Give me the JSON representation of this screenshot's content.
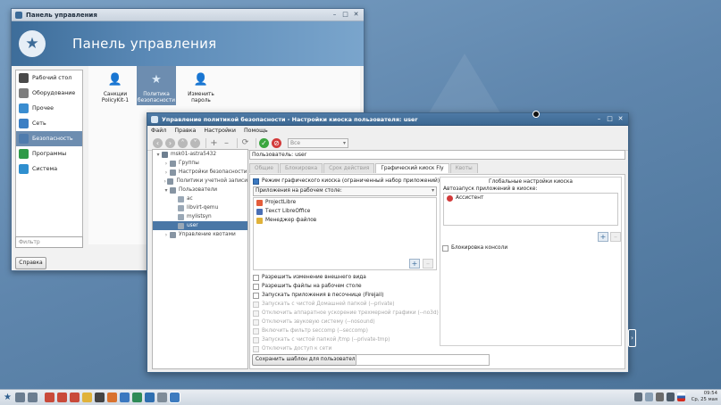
{
  "control_panel": {
    "window_title": "Панель управления",
    "banner_title": "Панель управления",
    "sidebar": [
      {
        "label": "Рабочий стол",
        "color": "#4a4a4a"
      },
      {
        "label": "Оборудование",
        "color": "#7e7e7e"
      },
      {
        "label": "Прочее",
        "color": "#3a8dd0"
      },
      {
        "label": "Сеть",
        "color": "#3b7fc4"
      },
      {
        "label": "Безопасность",
        "color": "#4f7cad"
      },
      {
        "label": "Программы",
        "color": "#2f9a48"
      },
      {
        "label": "Система",
        "color": "#2f8fcf"
      }
    ],
    "active_sidebar_index": 4,
    "tiles": [
      {
        "label": "Санкции PolicyKit-1",
        "icon": "user-admin-icon"
      },
      {
        "label": "Политика безопасности",
        "icon": "security-policy-icon"
      },
      {
        "label": "Изменить пароль",
        "icon": "change-password-icon"
      }
    ],
    "filter_placeholder": "Фильтр",
    "help_button": "Справка"
  },
  "security_window": {
    "title": "Управление политикой безопасности - Настройки киоска пользователя: user",
    "menu": [
      "Файл",
      "Правка",
      "Настройки",
      "Помощь"
    ],
    "toolbar_select": "Все",
    "tree": [
      {
        "label": "msk01-astra5432",
        "level": 0,
        "exp": "▾"
      },
      {
        "label": "Группы",
        "level": 1,
        "exp": "›"
      },
      {
        "label": "Настройки безопасности",
        "level": 1,
        "exp": "›"
      },
      {
        "label": "Политики учетной записи",
        "level": 1,
        "exp": "›"
      },
      {
        "label": "Пользователи",
        "level": 1,
        "exp": "▾"
      },
      {
        "label": "ac",
        "level": 2,
        "exp": ""
      },
      {
        "label": "libvirt-qemu",
        "level": 2,
        "exp": ""
      },
      {
        "label": "mylistsyn",
        "level": 2,
        "exp": ""
      },
      {
        "label": "user",
        "level": 2,
        "exp": ""
      },
      {
        "label": "Управление квотами",
        "level": 1,
        "exp": "›"
      }
    ],
    "selected_tree_index": 8,
    "user_field": "Пользователь: user",
    "tabs": [
      "Общие",
      "Блокировка",
      "Срок действия",
      "Графический киоск Fly",
      "Квоты"
    ],
    "active_tab_index": 3,
    "kiosk_mode_label": "Режим графического киоска (ограниченный набор приложений)",
    "apps_combo": "Приложения на рабочем столе:",
    "apps": [
      {
        "label": "ProjectLibre",
        "color": "#e45d3b"
      },
      {
        "label": "Текст LibreOffice",
        "color": "#4a6fb5"
      },
      {
        "label": "Менеджер файлов",
        "color": "#e0b23a"
      }
    ],
    "options": [
      {
        "label": "Разрешить изменение внешнего вида",
        "enabled": true
      },
      {
        "label": "Разрешить файлы на рабочем столе",
        "enabled": true
      },
      {
        "label": "Запускать приложения в песочнице (Firejail)",
        "enabled": true
      },
      {
        "label": "Запускать с чистой Домашней папкой (--private)",
        "enabled": false
      },
      {
        "label": "Отключить аппаратное ускорение трехмерной графики (--no3d)",
        "enabled": false
      },
      {
        "label": "Отключить звуковую систему (--nosound)",
        "enabled": false
      },
      {
        "label": "Включить фильтр seccomp (--seccomp)",
        "enabled": false
      },
      {
        "label": "Запускать с чистой папкой /tmp (--private-tmp)",
        "enabled": false
      },
      {
        "label": "Отключить доступ к сети",
        "enabled": false
      }
    ],
    "global_title": "Глобальные настройки киоска",
    "autostart_label": "Автозапуск приложений в киоске:",
    "autostart_items": [
      {
        "label": "Ассистент",
        "icon": "assistant-icon"
      }
    ],
    "console_lock_label": "Блокировка консоли",
    "save_template_button": "Сохранить шаблон для пользователя:"
  },
  "taskbar": {
    "time": "09:54",
    "date": "Ср, 25 мая"
  }
}
